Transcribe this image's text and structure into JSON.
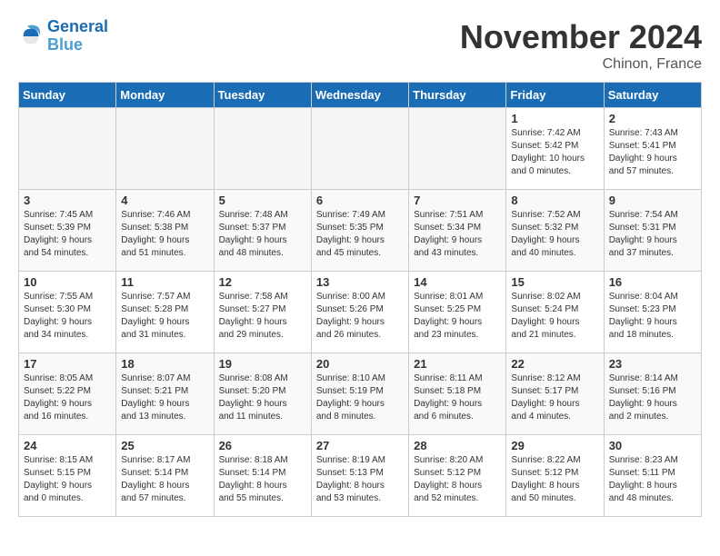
{
  "header": {
    "logo_line1": "General",
    "logo_line2": "Blue",
    "month": "November 2024",
    "location": "Chinon, France"
  },
  "weekdays": [
    "Sunday",
    "Monday",
    "Tuesday",
    "Wednesday",
    "Thursday",
    "Friday",
    "Saturday"
  ],
  "weeks": [
    [
      {
        "day": "",
        "info": ""
      },
      {
        "day": "",
        "info": ""
      },
      {
        "day": "",
        "info": ""
      },
      {
        "day": "",
        "info": ""
      },
      {
        "day": "",
        "info": ""
      },
      {
        "day": "1",
        "info": "Sunrise: 7:42 AM\nSunset: 5:42 PM\nDaylight: 10 hours\nand 0 minutes."
      },
      {
        "day": "2",
        "info": "Sunrise: 7:43 AM\nSunset: 5:41 PM\nDaylight: 9 hours\nand 57 minutes."
      }
    ],
    [
      {
        "day": "3",
        "info": "Sunrise: 7:45 AM\nSunset: 5:39 PM\nDaylight: 9 hours\nand 54 minutes."
      },
      {
        "day": "4",
        "info": "Sunrise: 7:46 AM\nSunset: 5:38 PM\nDaylight: 9 hours\nand 51 minutes."
      },
      {
        "day": "5",
        "info": "Sunrise: 7:48 AM\nSunset: 5:37 PM\nDaylight: 9 hours\nand 48 minutes."
      },
      {
        "day": "6",
        "info": "Sunrise: 7:49 AM\nSunset: 5:35 PM\nDaylight: 9 hours\nand 45 minutes."
      },
      {
        "day": "7",
        "info": "Sunrise: 7:51 AM\nSunset: 5:34 PM\nDaylight: 9 hours\nand 43 minutes."
      },
      {
        "day": "8",
        "info": "Sunrise: 7:52 AM\nSunset: 5:32 PM\nDaylight: 9 hours\nand 40 minutes."
      },
      {
        "day": "9",
        "info": "Sunrise: 7:54 AM\nSunset: 5:31 PM\nDaylight: 9 hours\nand 37 minutes."
      }
    ],
    [
      {
        "day": "10",
        "info": "Sunrise: 7:55 AM\nSunset: 5:30 PM\nDaylight: 9 hours\nand 34 minutes."
      },
      {
        "day": "11",
        "info": "Sunrise: 7:57 AM\nSunset: 5:28 PM\nDaylight: 9 hours\nand 31 minutes."
      },
      {
        "day": "12",
        "info": "Sunrise: 7:58 AM\nSunset: 5:27 PM\nDaylight: 9 hours\nand 29 minutes."
      },
      {
        "day": "13",
        "info": "Sunrise: 8:00 AM\nSunset: 5:26 PM\nDaylight: 9 hours\nand 26 minutes."
      },
      {
        "day": "14",
        "info": "Sunrise: 8:01 AM\nSunset: 5:25 PM\nDaylight: 9 hours\nand 23 minutes."
      },
      {
        "day": "15",
        "info": "Sunrise: 8:02 AM\nSunset: 5:24 PM\nDaylight: 9 hours\nand 21 minutes."
      },
      {
        "day": "16",
        "info": "Sunrise: 8:04 AM\nSunset: 5:23 PM\nDaylight: 9 hours\nand 18 minutes."
      }
    ],
    [
      {
        "day": "17",
        "info": "Sunrise: 8:05 AM\nSunset: 5:22 PM\nDaylight: 9 hours\nand 16 minutes."
      },
      {
        "day": "18",
        "info": "Sunrise: 8:07 AM\nSunset: 5:21 PM\nDaylight: 9 hours\nand 13 minutes."
      },
      {
        "day": "19",
        "info": "Sunrise: 8:08 AM\nSunset: 5:20 PM\nDaylight: 9 hours\nand 11 minutes."
      },
      {
        "day": "20",
        "info": "Sunrise: 8:10 AM\nSunset: 5:19 PM\nDaylight: 9 hours\nand 8 minutes."
      },
      {
        "day": "21",
        "info": "Sunrise: 8:11 AM\nSunset: 5:18 PM\nDaylight: 9 hours\nand 6 minutes."
      },
      {
        "day": "22",
        "info": "Sunrise: 8:12 AM\nSunset: 5:17 PM\nDaylight: 9 hours\nand 4 minutes."
      },
      {
        "day": "23",
        "info": "Sunrise: 8:14 AM\nSunset: 5:16 PM\nDaylight: 9 hours\nand 2 minutes."
      }
    ],
    [
      {
        "day": "24",
        "info": "Sunrise: 8:15 AM\nSunset: 5:15 PM\nDaylight: 9 hours\nand 0 minutes."
      },
      {
        "day": "25",
        "info": "Sunrise: 8:17 AM\nSunset: 5:14 PM\nDaylight: 8 hours\nand 57 minutes."
      },
      {
        "day": "26",
        "info": "Sunrise: 8:18 AM\nSunset: 5:14 PM\nDaylight: 8 hours\nand 55 minutes."
      },
      {
        "day": "27",
        "info": "Sunrise: 8:19 AM\nSunset: 5:13 PM\nDaylight: 8 hours\nand 53 minutes."
      },
      {
        "day": "28",
        "info": "Sunrise: 8:20 AM\nSunset: 5:12 PM\nDaylight: 8 hours\nand 52 minutes."
      },
      {
        "day": "29",
        "info": "Sunrise: 8:22 AM\nSunset: 5:12 PM\nDaylight: 8 hours\nand 50 minutes."
      },
      {
        "day": "30",
        "info": "Sunrise: 8:23 AM\nSunset: 5:11 PM\nDaylight: 8 hours\nand 48 minutes."
      }
    ]
  ]
}
